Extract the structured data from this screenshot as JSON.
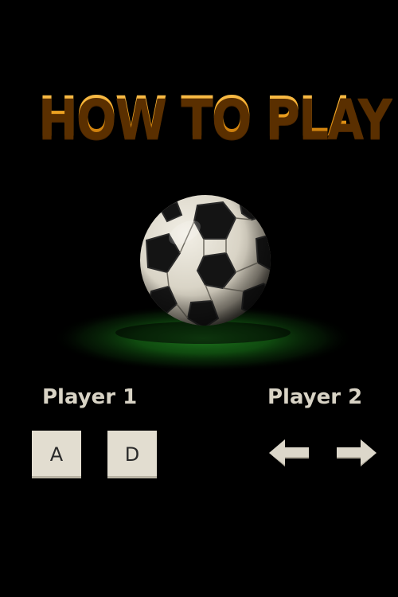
{
  "screen": {
    "title": "HOW TO PLAY"
  },
  "players": [
    {
      "label": "Player 1",
      "keys": [
        {
          "label": "A",
          "action": "move-left"
        },
        {
          "label": "D",
          "action": "move-right"
        }
      ]
    },
    {
      "label": "Player 2",
      "keys": [
        {
          "icon": "arrow-left-icon",
          "action": "move-left"
        },
        {
          "icon": "arrow-right-icon",
          "action": "move-right"
        }
      ]
    }
  ],
  "colors": {
    "background": "#000000",
    "title_gold": "#f2a826",
    "label_text": "#d8d3c5",
    "key_face": "#e2ddd0",
    "ball_glow": "#1f7a1f"
  }
}
